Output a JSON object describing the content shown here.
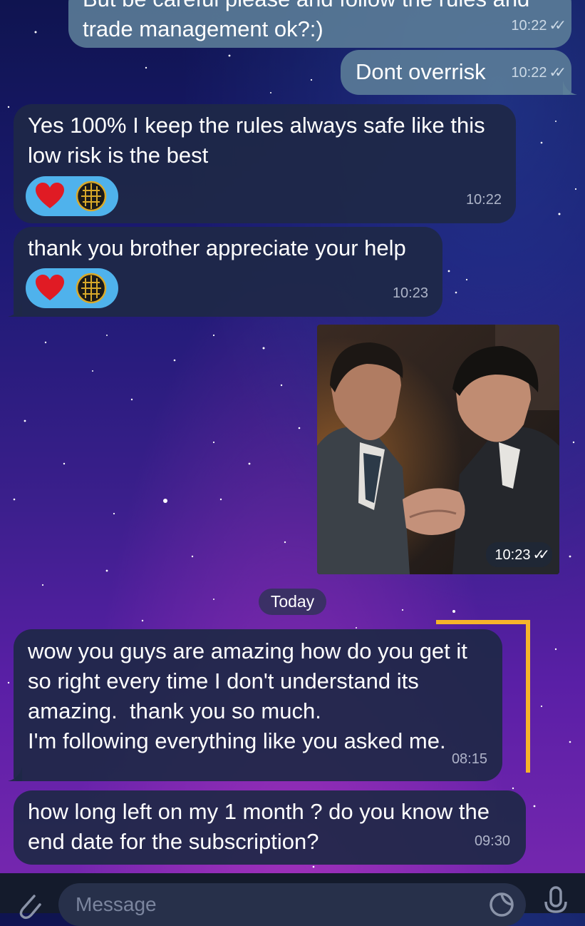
{
  "messages": [
    {
      "text": "But be careful please and follow the rules and\ntrade management ok?:)",
      "time": "10:22",
      "direction": "outgoing",
      "read": true
    },
    {
      "text": "Dont overrisk",
      "time": "10:22",
      "direction": "outgoing",
      "read": true
    },
    {
      "text": "Yes 100% I keep the rules always safe like this\nlow risk is the best",
      "time": "10:22",
      "direction": "incoming",
      "reactions": [
        "heart-icon",
        "globe-emblem-icon"
      ]
    },
    {
      "text": "thank you brother appreciate your help",
      "time": "10:23",
      "direction": "incoming",
      "reactions": [
        "heart-icon",
        "globe-emblem-icon"
      ]
    },
    {
      "type": "photo",
      "time": "10:23",
      "direction": "outgoing",
      "read": true
    },
    {
      "text": "wow you guys are amazing how do you get it\nso right every time I don't understand its\namazing.  thank you so much.\nI'm following everything like you asked me.",
      "time": "08:15",
      "direction": "incoming"
    },
    {
      "text": "how long left on my 1 month ? do you know the\nend date for the subscription?",
      "time": "09:30",
      "direction": "incoming"
    }
  ],
  "date_divider": "Today",
  "composer": {
    "placeholder": "Message"
  },
  "colors": {
    "incoming_bubble": "#1e2846",
    "outgoing_bubble": "#5c7e98",
    "reaction_pill": "#4fb2ec",
    "highlight_bracket": "#f6b42a"
  }
}
